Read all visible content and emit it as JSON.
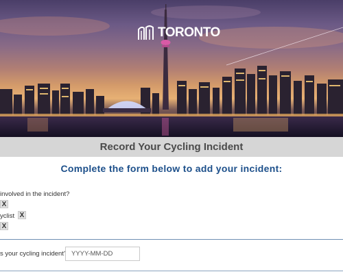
{
  "header": {
    "logo_text": "TORONTO"
  },
  "title_bar": {
    "title": "Record Your Cycling Incident"
  },
  "form": {
    "subtitle": "Complete the form below to add your incident:",
    "question_involved": "involved in the incident?",
    "option_cyclist_label": "yclist",
    "remove_label": "X",
    "question_date": "s your cycling incident?",
    "date_placeholder": "YYYY-MM-DD"
  }
}
